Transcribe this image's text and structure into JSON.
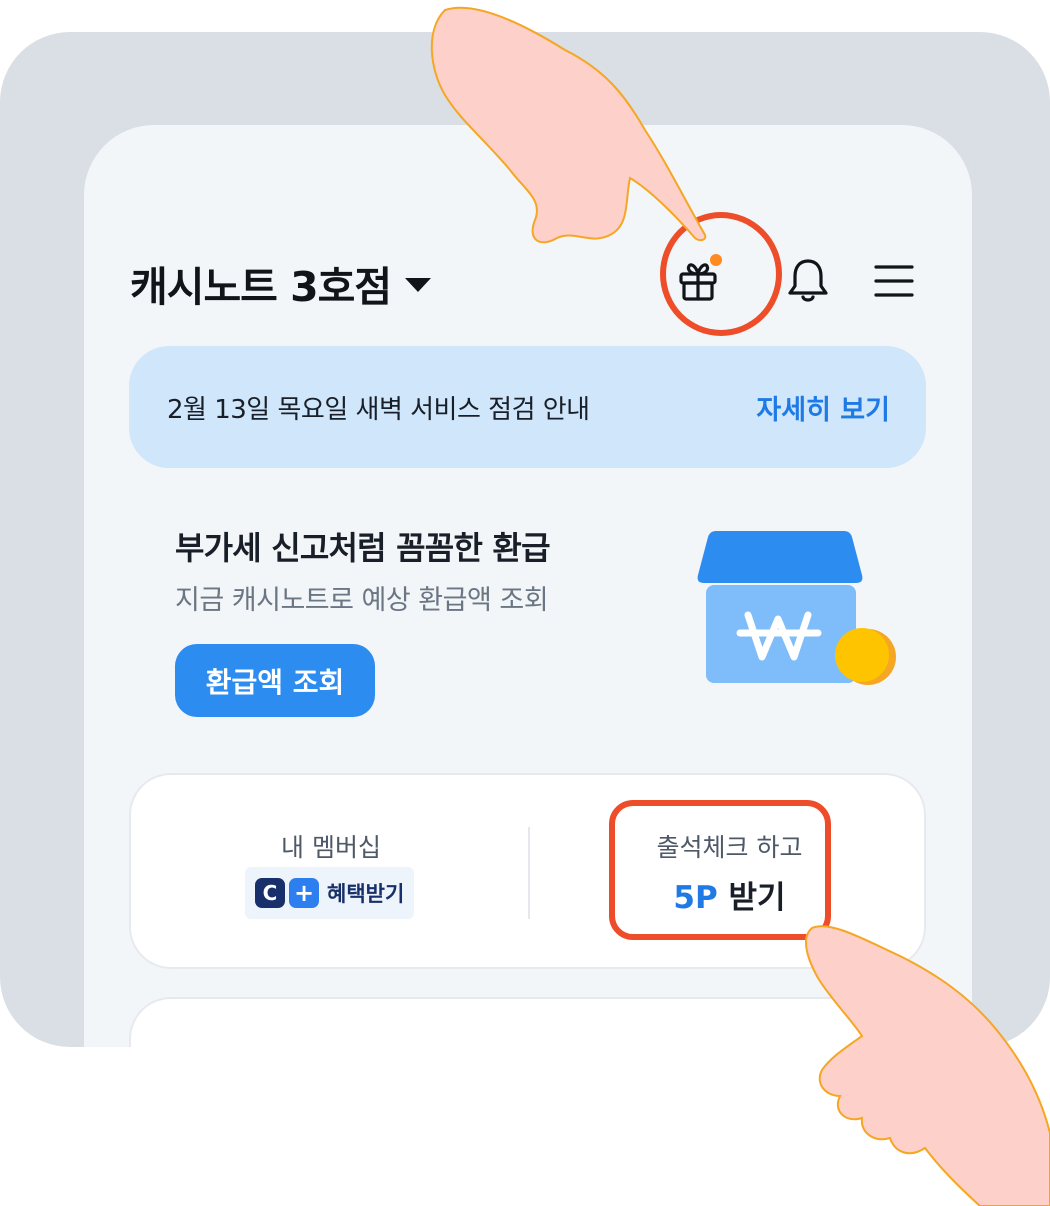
{
  "header": {
    "store_name": "캐시노트 3호점",
    "icons": [
      "caret-down-icon",
      "gift-icon",
      "bell-icon",
      "menu-icon"
    ],
    "gift_has_notification": true
  },
  "notice": {
    "text": "2월 13일 목요일 새벽 서비스 점검 안내",
    "link_label": "자세히 보기"
  },
  "promo": {
    "title": "부가세 신고처럼 꼼꼼한 환급",
    "subtitle": "지금 캐시노트로 예상 환급액 조회",
    "button_label": "환급액 조회",
    "illustration": "shop-won-icon"
  },
  "membership": {
    "label": "내 멤버십",
    "chip_c": "C",
    "chip_plus": "+",
    "chip_text": "혜택받기"
  },
  "attendance": {
    "label": "출석체크 하고",
    "reward_points": "5P",
    "reward_suffix": " 받기"
  },
  "colors": {
    "accent": "#1f7ae6",
    "button": "#2d8cf0",
    "notice_bg": "#cfe6fb",
    "highlight": "#ee4d2a",
    "notification_dot": "#ff8a1f",
    "hand": "#fed0ca"
  }
}
